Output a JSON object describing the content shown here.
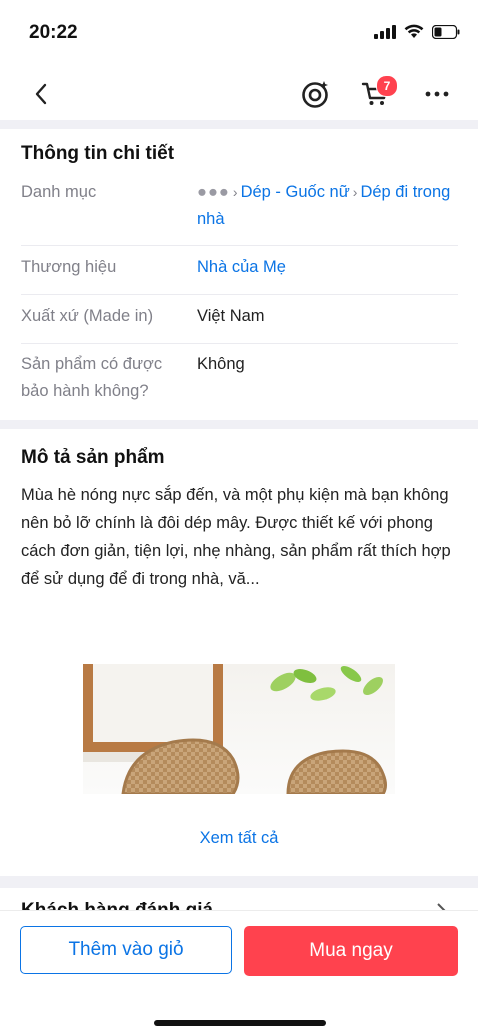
{
  "status_bar": {
    "time": "20:22"
  },
  "nav": {
    "cart_count": "7",
    "icons": [
      "back-arrow-icon",
      "live-icon",
      "cart-icon",
      "more-icon"
    ]
  },
  "details": {
    "title": "Thông tin chi tiết",
    "rows": [
      {
        "label": "Danh mục",
        "breadcrumb": [
          "Dép - Guốc nữ",
          "Dép đi trong nhà"
        ]
      },
      {
        "label": "Thương hiệu",
        "value": "Nhà của Mẹ"
      },
      {
        "label": "Xuất xứ (Made in)",
        "value": "Việt Nam"
      },
      {
        "label": "Sản phẩm có được bảo hành không?",
        "value": "Không"
      }
    ]
  },
  "description": {
    "title": "Mô tả sản phẩm",
    "text": "Mùa hè nóng nực sắp đến, và một phụ kiện mà bạn không nên bỏ lỡ chính là đôi dép mây. Được thiết kế với phong cách đơn giản, tiện lợi, nhẹ nhàng, sản phẩm rất thích hợp để sử dụng để đi trong nhà, vă...",
    "see_all": "Xem tất cả"
  },
  "reviews": {
    "title": "Khách hàng đánh giá"
  },
  "actions": {
    "add_to_cart": "Thêm vào giỏ",
    "buy_now": "Mua ngay"
  },
  "colors": {
    "link": "#0b74e5",
    "buy": "#ff424e",
    "badge": "#ff424f",
    "label": "#808089"
  }
}
